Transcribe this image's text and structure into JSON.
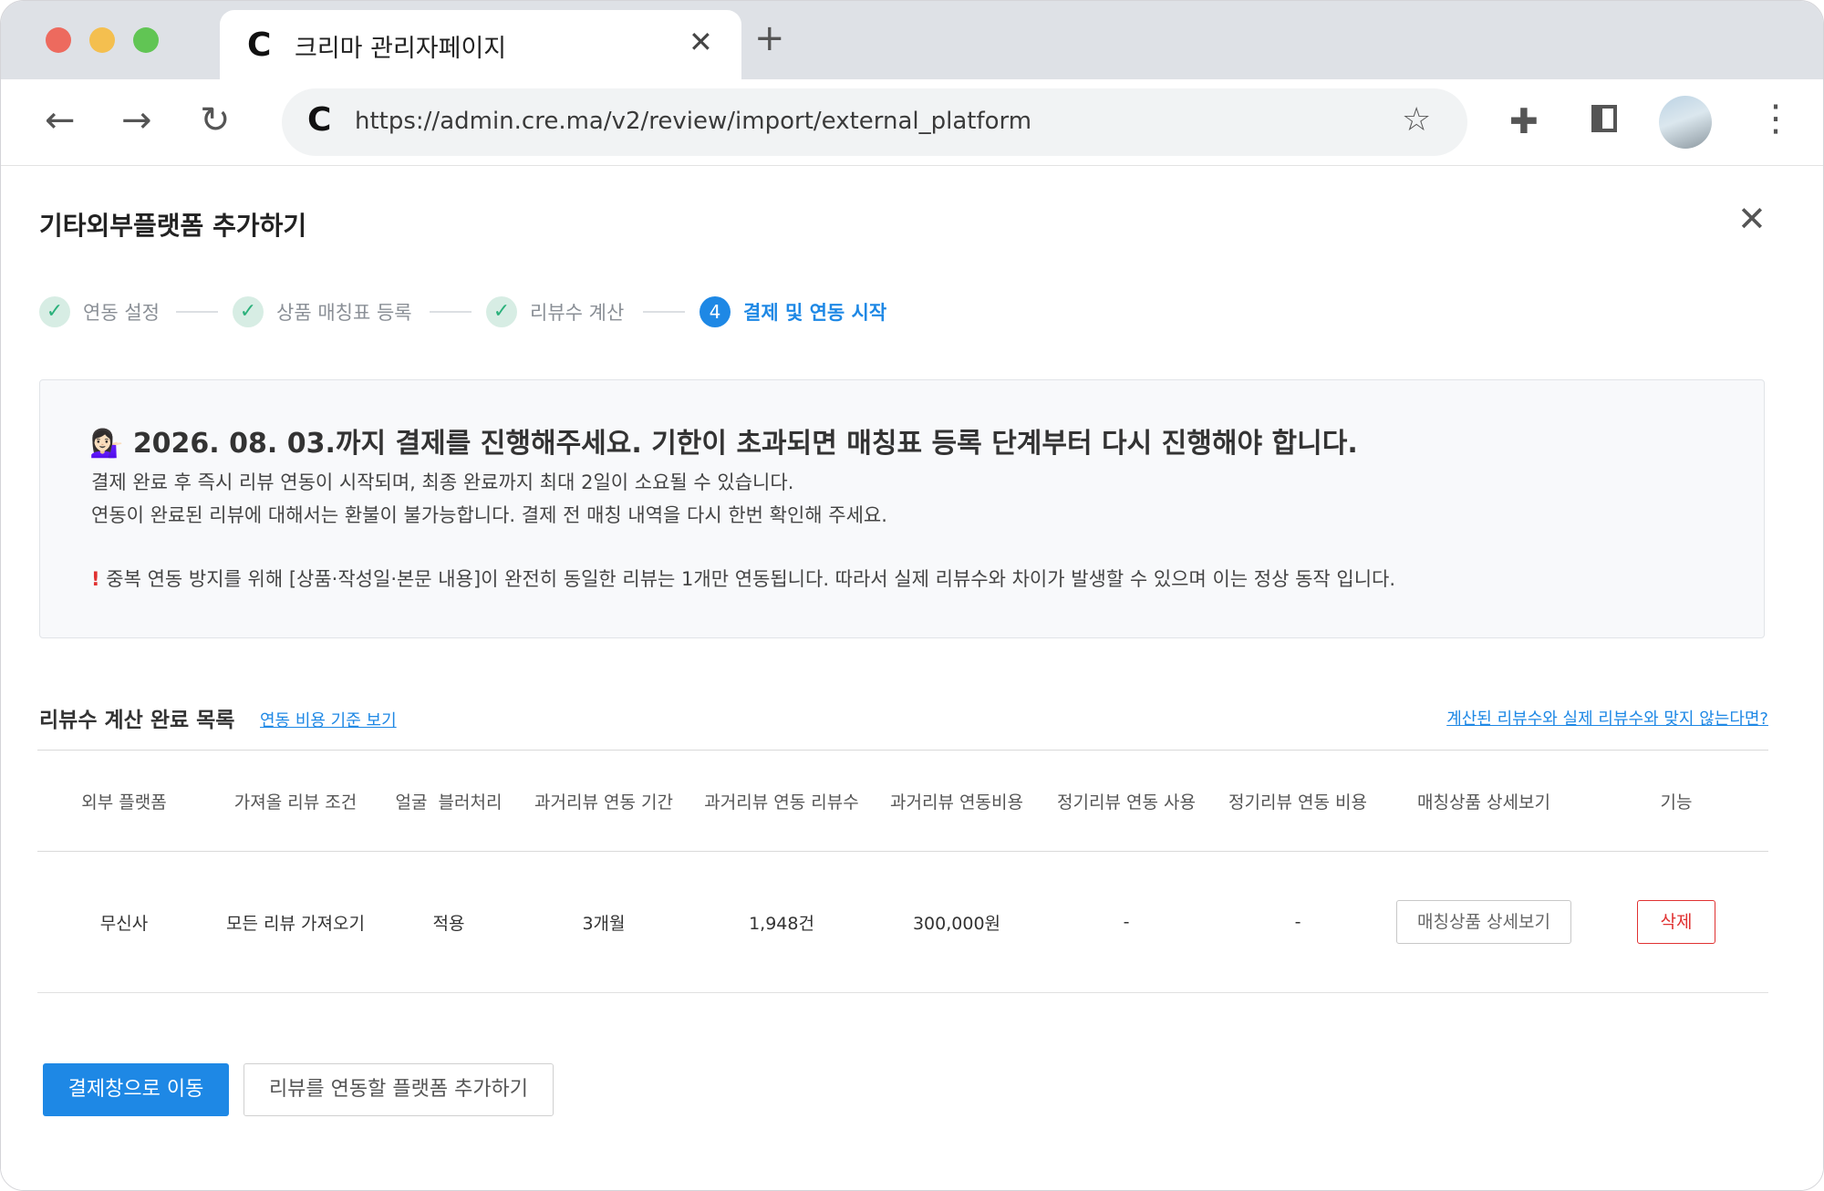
{
  "browser": {
    "tab_logo": "C",
    "tab_title": "크리마 관리자페이지",
    "tab_close": "✕",
    "new_tab": "+",
    "back": "←",
    "forward": "→",
    "reload": "↻",
    "url_logo": "C",
    "url": "https://admin.cre.ma/v2/review/import/external_platform",
    "star": "☆",
    "extensions": "✚",
    "menu": "⋮"
  },
  "page": {
    "title": "기타외부플랫폼 추가하기",
    "close": "✕",
    "steps": [
      {
        "label": "연동 설정",
        "state": "done"
      },
      {
        "label": "상품 매칭표 등록",
        "state": "done"
      },
      {
        "label": "리뷰수 계산",
        "state": "done"
      },
      {
        "label": "결제 및 연동 시작",
        "state": "active",
        "number": "4"
      }
    ],
    "check_mark": "✓",
    "notice": {
      "emoji": "💁🏻‍♀️",
      "headline": "2026. 08. 03.까지 결제를 진행해주세요. 기한이 초과되면 매칭표 등록 단계부터 다시 진행해야 합니다.",
      "line1": "결제 완료 후 즉시 리뷰 연동이 시작되며, 최종 완료까지 최대 2일이 소요될 수 있습니다.",
      "line2": "연동이 완료된 리뷰에 대해서는 환불이 불가능합니다. 결제 전 매칭 내역을 다시 한번 확인해 주세요.",
      "warning_mark": "!",
      "line3": "중복 연동 방지를 위해 [상품·작성일·본문 내용]이 완전히 동일한 리뷰는 1개만 연동됩니다. 따라서 실제 리뷰수와 차이가 발생할 수 있으며 이는 정상 동작 입니다."
    },
    "section_title": "리뷰수 계산 완료 목록",
    "cost_link": "연동 비용 기준 보기",
    "mismatch_link": "계산된 리뷰수와 실제 리뷰수와 맞지 않는다면?",
    "table": {
      "headers": [
        "외부 플랫폼",
        "가져올 리뷰 조건",
        "얼굴  블러처리",
        "과거리뷰 연동 기간",
        "과거리뷰 연동 리뷰수",
        "과거리뷰 연동비용",
        "정기리뷰 연동 사용",
        "정기리뷰 연동 비용",
        "매칭상품 상세보기",
        "기능"
      ],
      "row": {
        "platform": "무신사",
        "condition": "모든 리뷰 가져오기",
        "blur": "적용",
        "period": "3개월",
        "count": "1,948건",
        "cost": "300,000원",
        "regular_use": "-",
        "regular_cost": "-",
        "detail_button": "매칭상품 상세보기",
        "delete_button": "삭제"
      }
    },
    "primary_button": "결제창으로 이동",
    "secondary_button": "리뷰를 연동할 플랫폼 추가하기"
  },
  "colors": {
    "accent": "#1e88e5",
    "danger": "#e03131",
    "check_bg": "#d7ede4",
    "check_fg": "#2bb17b"
  }
}
